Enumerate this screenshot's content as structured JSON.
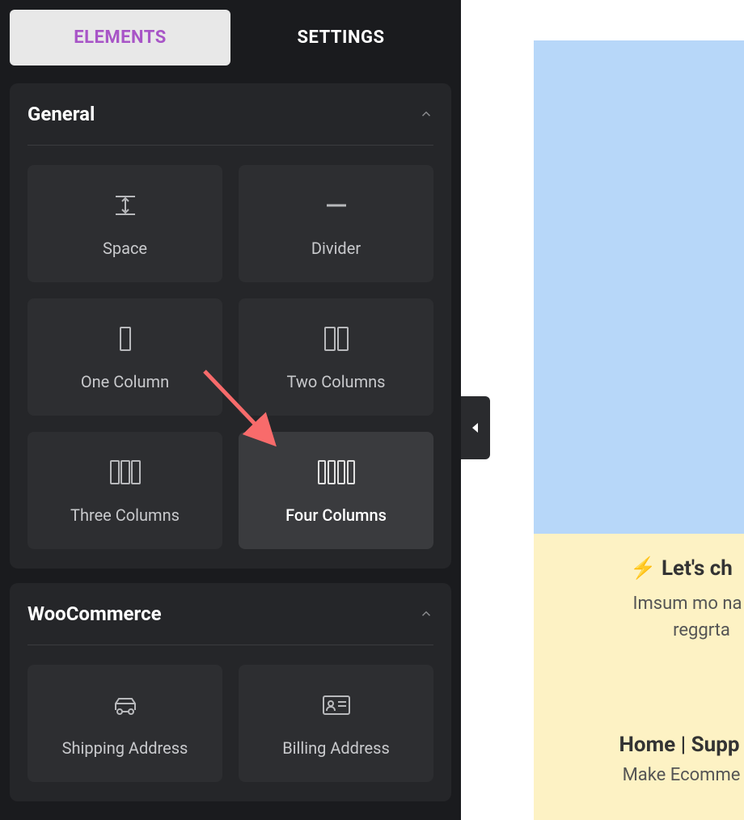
{
  "tabs": {
    "elements": "ELEMENTS",
    "settings": "SETTINGS"
  },
  "sections": {
    "general": {
      "title": "General",
      "items": [
        {
          "label": "Space",
          "icon": "space"
        },
        {
          "label": "Divider",
          "icon": "divider"
        },
        {
          "label": "One Column",
          "icon": "col1"
        },
        {
          "label": "Two Columns",
          "icon": "col2"
        },
        {
          "label": "Three Columns",
          "icon": "col3"
        },
        {
          "label": "Four Columns",
          "icon": "col4"
        }
      ]
    },
    "woocommerce": {
      "title": "WooCommerce",
      "items": [
        {
          "label": "Shipping Address",
          "icon": "shipping"
        },
        {
          "label": "Billing Address",
          "icon": "billing"
        }
      ]
    }
  },
  "preview": {
    "bolt_emoji": "⚡",
    "headline": " Let's ch",
    "sub1": "Imsum mo na",
    "sub2": "reggrta",
    "footer_links": "Home | Supp",
    "footer_sub": "Make Ecomme"
  }
}
